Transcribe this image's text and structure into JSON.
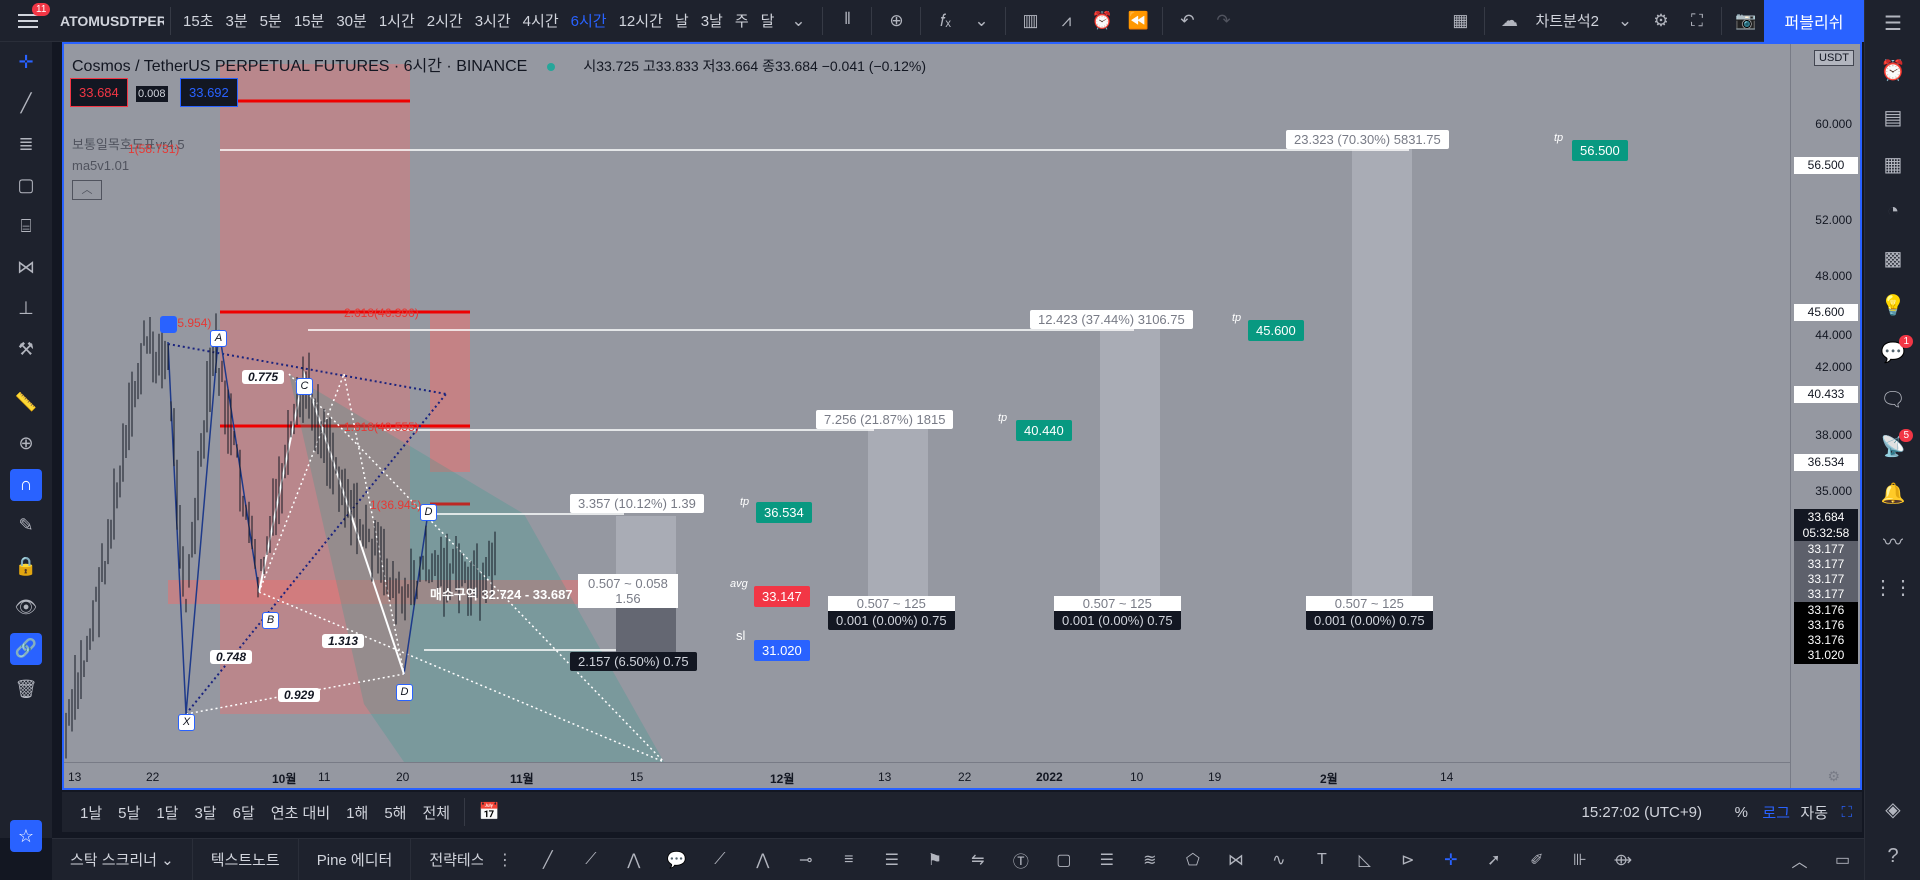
{
  "topbar": {
    "menu_badge": "11",
    "symbol": "ATOMUSDTPERP",
    "intervals": [
      "15초",
      "3분",
      "5분",
      "15분",
      "30분",
      "1시간",
      "2시간",
      "3시간",
      "4시간",
      "6시간",
      "12시간",
      "날",
      "3날",
      "주",
      "달"
    ],
    "active_interval": "6시간",
    "layout_name": "차트분석2",
    "publish_label": "퍼블리쉬"
  },
  "legend": {
    "title": "Cosmos / TetherUS PERPETUAL FUTURES · 6시간 · BINANCE",
    "ohlc": "시33.725 고33.833 저33.664 종33.684 −0.041 (−0.12%)",
    "sell_price": "33.684",
    "spread": "0.008",
    "buy_price": "33.692",
    "indicators": [
      "보통일목호도표vr4.5",
      "ma5v1.01"
    ]
  },
  "price_axis": {
    "unit": "USDT",
    "labels": [
      "60.000",
      "56.000",
      "52.000",
      "48.000",
      "44.000",
      "42.000",
      "40.000",
      "38.000",
      "35.000"
    ],
    "badges": [
      {
        "text": "56.500",
        "bg": "#ffffff",
        "fg": "#131722"
      },
      {
        "text": "45.600",
        "bg": "#ffffff",
        "fg": "#131722"
      },
      {
        "text": "40.433",
        "bg": "#ffffff",
        "fg": "#131722"
      },
      {
        "text": "36.534",
        "bg": "#ffffff",
        "fg": "#131722"
      },
      {
        "text": "33.684",
        "bg": "#131722",
        "fg": "#ffffff"
      },
      {
        "text": "05:32:58",
        "bg": "#131722",
        "fg": "#ffffff"
      },
      {
        "text": "33.177",
        "bg": "#5d606b",
        "fg": "#ffffff"
      },
      {
        "text": "33.177",
        "bg": "#5d606b",
        "fg": "#ffffff"
      },
      {
        "text": "33.177",
        "bg": "#5d606b",
        "fg": "#ffffff"
      },
      {
        "text": "33.177",
        "bg": "#5d606b",
        "fg": "#ffffff"
      },
      {
        "text": "33.176",
        "bg": "#000000",
        "fg": "#ffffff"
      },
      {
        "text": "33.176",
        "bg": "#000000",
        "fg": "#ffffff"
      },
      {
        "text": "33.176",
        "bg": "#000000",
        "fg": "#ffffff"
      },
      {
        "text": "31.020",
        "bg": "#000000",
        "fg": "#ffffff"
      }
    ]
  },
  "time_axis": [
    "13",
    "22",
    "10월",
    "11",
    "20",
    "11월",
    "15",
    "12월",
    "13",
    "22",
    "2022",
    "10",
    "19",
    "2월",
    "14"
  ],
  "annotations": {
    "targets": [
      {
        "text": "23.323 (70.30%) 5831.75",
        "tp_label": "tp",
        "price": "56.500"
      },
      {
        "text": "12.423 (37.44%) 3106.75",
        "tp_label": "tp",
        "price": "45.600"
      },
      {
        "text": "7.256 (21.87%) 1815",
        "tp_label": "tp",
        "price": "40.440"
      },
      {
        "text": "3.357 (10.12%) 1.39",
        "tp_label": "tp",
        "price": "36.534"
      }
    ],
    "entry": {
      "text": "0.507 ~ 0.058",
      "sub": "1.56",
      "avg_label": "avg",
      "price": "33.147"
    },
    "entries_right": [
      {
        "top": "0.507 ~ 125",
        "bottom": "0.001 (0.00%) 0.75"
      },
      {
        "top": "0.507 ~ 125",
        "bottom": "0.001 (0.00%) 0.75"
      },
      {
        "top": "0.507 ~ 125",
        "bottom": "0.001 (0.00%) 0.75"
      }
    ],
    "stop": {
      "text": "2.157 (6.50%) 0.75",
      "sl_label": "sl",
      "price": "31.020"
    },
    "buy_zone": "매수구역 32.724 - 33.687",
    "fib_levels": [
      "1(58.731)",
      "2.618(46.396)",
      "1.618(40.555)",
      "1(36.945)",
      "1(45.954)"
    ],
    "points": [
      "X",
      "A",
      "B",
      "C",
      "D",
      "D"
    ],
    "ratios": [
      "0.775",
      "0.748",
      "1.313",
      "0.929"
    ]
  },
  "rangebar": {
    "ranges": [
      "1날",
      "5날",
      "1달",
      "3달",
      "6달",
      "연초 대비",
      "1해",
      "5해",
      "전체"
    ],
    "clock": "15:27:02 (UTC+9)",
    "percent": "%",
    "log": "로그",
    "auto": "자동"
  },
  "footer": {
    "tabs": [
      "스탁 스크리너",
      "텍스트노트",
      "Pine 에디터",
      "전략테스터"
    ]
  },
  "rightbar": {
    "badges": [
      "1",
      "5"
    ]
  },
  "colors": {
    "accent": "#2962ff",
    "bull": "#089981",
    "bear": "#f23645",
    "tp": "#089981",
    "sl": "#2962ff"
  }
}
